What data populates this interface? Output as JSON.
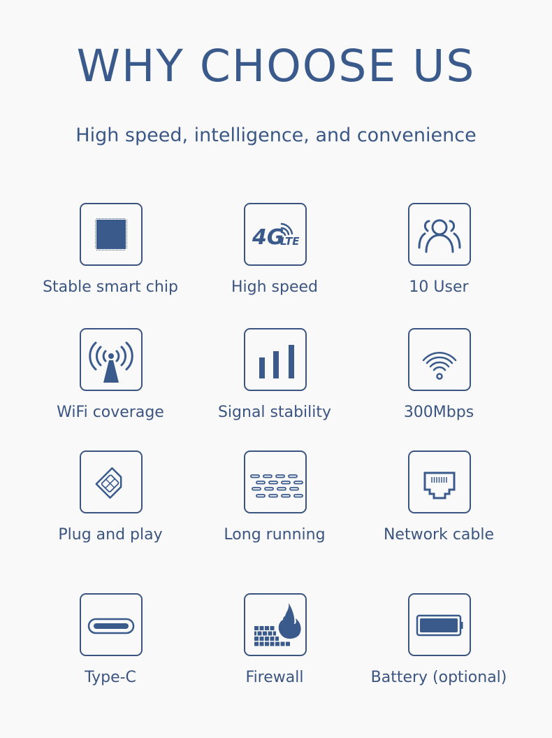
{
  "header": {
    "title": "WHY CHOOSE US",
    "subtitle": "High speed, intelligence, and convenience"
  },
  "colors": {
    "primary": "#3a5a8c",
    "background": "#f9f9fa"
  },
  "features": [
    {
      "label": "Stable smart chip",
      "icon": "chip-icon"
    },
    {
      "label": "High speed",
      "icon": "4g-lte-icon",
      "icon_text": "4G",
      "icon_subtext": "LTE"
    },
    {
      "label": "10 User",
      "icon": "users-icon"
    },
    {
      "label": "WiFi coverage",
      "icon": "broadcast-antenna-icon"
    },
    {
      "label": "Signal stability",
      "icon": "signal-bars-icon"
    },
    {
      "label": "300Mbps",
      "icon": "wifi-icon"
    },
    {
      "label": "Plug and play",
      "icon": "sim-card-icon"
    },
    {
      "label": "Long running",
      "icon": "dashes-icon"
    },
    {
      "label": "Network cable",
      "icon": "ethernet-port-icon"
    },
    {
      "label": "Type-C",
      "icon": "usb-c-icon"
    },
    {
      "label": "Firewall",
      "icon": "firewall-icon"
    },
    {
      "label": "Battery (optional)",
      "icon": "battery-icon"
    }
  ]
}
